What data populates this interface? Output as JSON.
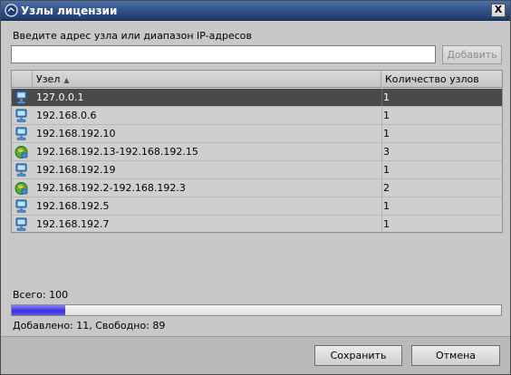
{
  "window": {
    "title": "Узлы лицензии",
    "close_label": "X"
  },
  "address": {
    "label": "Введите адрес узла или диапазон IP-адресов",
    "value": "",
    "placeholder": "",
    "add_label": "Добавить"
  },
  "table": {
    "columns": {
      "node": "Узел",
      "count": "Количество узлов"
    },
    "sort": "ascending",
    "rows": [
      {
        "node": "127.0.0.1",
        "count": "1",
        "icon": "computer-icon",
        "selected": true
      },
      {
        "node": "192.168.0.6",
        "count": "1",
        "icon": "computer-icon"
      },
      {
        "node": "192.168.192.10",
        "count": "1",
        "icon": "computer-icon"
      },
      {
        "node": "192.168.192.13-192.168.192.15",
        "count": "3",
        "icon": "network-range-icon"
      },
      {
        "node": "192.168.192.19",
        "count": "1",
        "icon": "computer-icon"
      },
      {
        "node": "192.168.192.2-192.168.192.3",
        "count": "2",
        "icon": "network-range-icon"
      },
      {
        "node": "192.168.192.5",
        "count": "1",
        "icon": "computer-icon"
      },
      {
        "node": "192.168.192.7",
        "count": "1",
        "icon": "computer-icon"
      }
    ]
  },
  "summary": {
    "total": "Всего: 100",
    "status": "Добавлено: 11, Свободно: 89",
    "progress_fraction": 0.11
  },
  "buttons": {
    "save": "Сохранить",
    "cancel": "Отмена"
  },
  "colors": {
    "titlebar": "#2f4f86",
    "selected_row": "#4a4a4a",
    "progress_fill": "#3a30d8"
  }
}
